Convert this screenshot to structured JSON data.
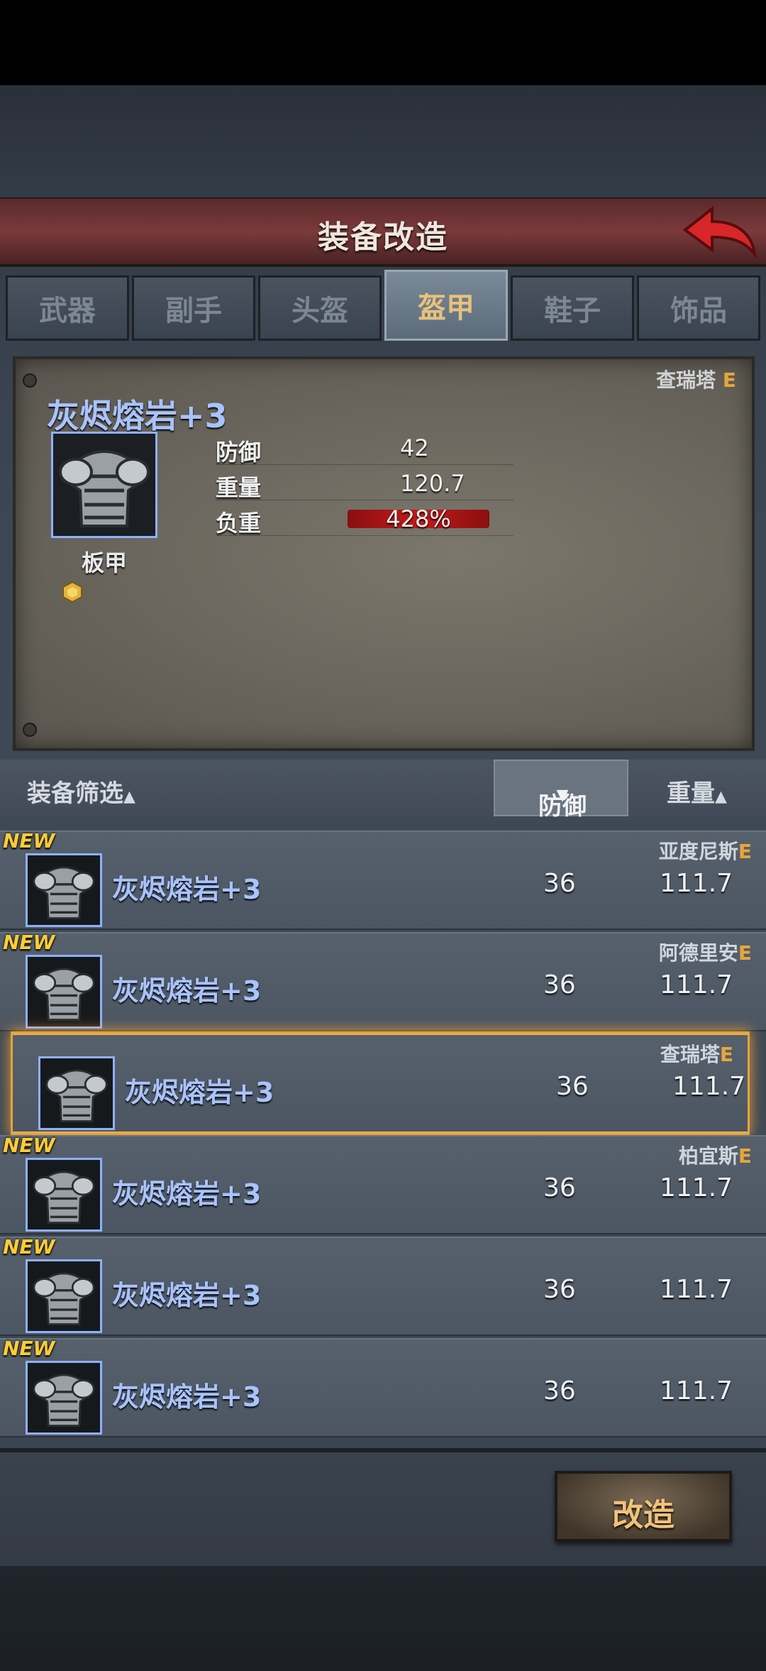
{
  "header": {
    "title": "装备改造"
  },
  "tabs": [
    {
      "label": "武器"
    },
    {
      "label": "副手"
    },
    {
      "label": "头盔"
    },
    {
      "label": "盔甲",
      "active": true
    },
    {
      "label": "鞋子"
    },
    {
      "label": "饰品"
    }
  ],
  "selected_item": {
    "owner": "查瑞塔",
    "owner_grade": "E",
    "name": "灰烬熔岩+3",
    "type": "板甲",
    "stats": [
      {
        "label": "防御",
        "value": "42"
      },
      {
        "label": "重量",
        "value": "120.7"
      },
      {
        "label": "负重",
        "value": "428%"
      }
    ]
  },
  "filter": {
    "label": "装备筛选",
    "sort_defense": "防御",
    "sort_weight": "重量"
  },
  "items": [
    {
      "new": "NEW",
      "owner": "亚度尼斯",
      "grade": "E",
      "name": "灰烬熔岩+3",
      "defense": "36",
      "weight": "111.7",
      "selected": false
    },
    {
      "new": "NEW",
      "owner": "阿德里安",
      "grade": "E",
      "name": "灰烬熔岩+3",
      "defense": "36",
      "weight": "111.7",
      "selected": false
    },
    {
      "new": "",
      "owner": "查瑞塔",
      "grade": "E",
      "name": "灰烬熔岩+3",
      "defense": "36",
      "weight": "111.7",
      "selected": true
    },
    {
      "new": "NEW",
      "owner": "柏宜斯",
      "grade": "E",
      "name": "灰烬熔岩+3",
      "defense": "36",
      "weight": "111.7",
      "selected": false
    },
    {
      "new": "NEW",
      "owner": "",
      "grade": "",
      "name": "灰烬熔岩+3",
      "defense": "36",
      "weight": "111.7",
      "selected": false
    },
    {
      "new": "NEW",
      "owner": "",
      "grade": "",
      "name": "灰烬熔岩+3",
      "defense": "36",
      "weight": "111.7",
      "selected": false
    }
  ],
  "actions": {
    "upgrade_label": "改造"
  },
  "colors": {
    "accent_gold": "#e8a53b",
    "name_blue": "#a9c3ff",
    "title_red": "#7b3a3b"
  }
}
